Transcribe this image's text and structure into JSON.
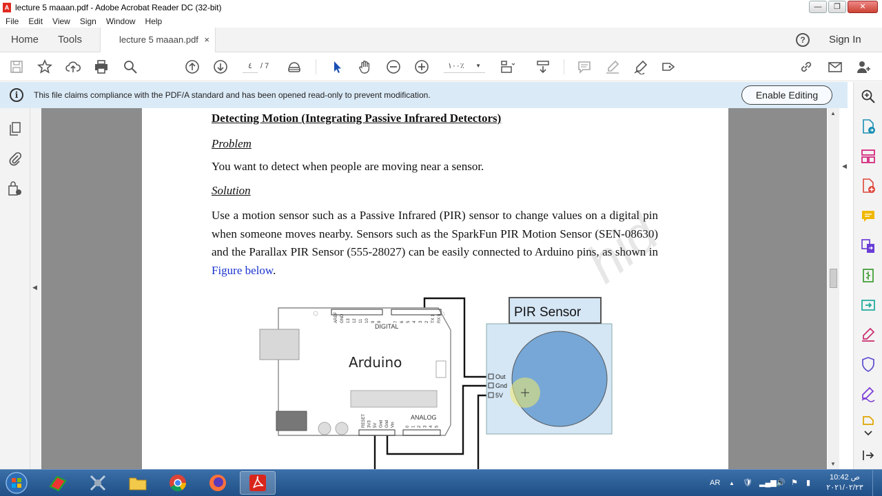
{
  "window": {
    "title": "lecture 5 maaan.pdf - Adobe Acrobat Reader DC (32-bit)",
    "controls": {
      "minimize": "—",
      "maximize": "❐",
      "close": "✕"
    }
  },
  "menu": [
    "File",
    "Edit",
    "View",
    "Sign",
    "Window",
    "Help"
  ],
  "tabs": {
    "home": "Home",
    "tools": "Tools",
    "document": "lecture 5 maaan.pdf",
    "close": "×",
    "help": "?",
    "sign_in": "Sign In"
  },
  "toolbar": {
    "page_current": "٤",
    "page_total": "/ 7",
    "zoom": "١٠٠٪"
  },
  "infobar": {
    "message": "This file claims compliance with the PDF/A standard and has been opened read-only to prevent modification.",
    "enable_button": "Enable Editing"
  },
  "document": {
    "heading": "Detecting Motion (Integrating Passive Infrared Detectors)",
    "problem_label": "Problem",
    "problem_text": "You want to detect when people are moving near a sensor.",
    "solution_label": "Solution",
    "solution_text": "Use a motion sensor such as a Passive Infrared (PIR) sensor to change values on a digital pin when someone moves nearby. Sensors such as the SparkFun PIR Motion Sensor (SEN-08630) and the Parallax PIR Sensor (555-28027) can be easily connected to Arduino pins, as shown in",
    "figure_link": "Figure below",
    "solution_end": ".",
    "watermark": "hid",
    "figure": {
      "board_label": "Arduino",
      "digital_label": "DIGITAL",
      "analog_label": "ANALOG",
      "sensor_title": "PIR Sensor",
      "pin_out": "Out",
      "pin_gnd": "Gnd",
      "pin_5v": "5V",
      "digital_pins": [
        "AREF",
        "GND",
        "13",
        "12",
        "11",
        "10",
        "9",
        "8",
        "7",
        "6",
        "5",
        "4",
        "3",
        "2",
        "TX 1",
        "RX 0"
      ],
      "power_pins": [
        "RESET",
        "3V3",
        "5V",
        "Gnd",
        "Gnd",
        "Vin"
      ],
      "analog_pins": [
        "0",
        "1",
        "2",
        "3",
        "4",
        "5"
      ]
    }
  },
  "taskbar": {
    "language": "AR",
    "time": "10:42 ص",
    "date": "٢٠٢١/٠٢/٢٣"
  },
  "colors": {
    "infobar_bg": "#dbeaf7",
    "doc_gray": "#8c8c8c",
    "link_blue": "#1a33cc",
    "sensor_blue": "#76a7d6",
    "taskbar": "#2a5c95"
  }
}
